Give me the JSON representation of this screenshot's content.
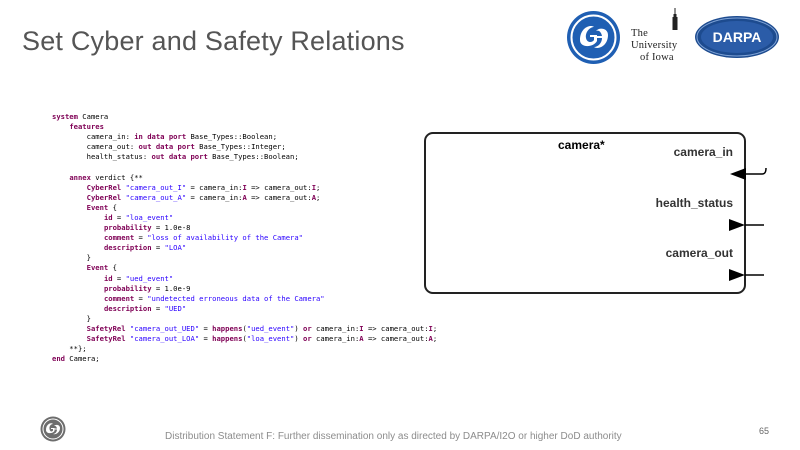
{
  "slide": {
    "title": "Set Cyber and Safety Relations",
    "page_number": "65",
    "footer": "Distribution Statement F: Further dissemination  only as directed by DARPA/I2O or higher DoD authority"
  },
  "logos": {
    "ge": "ge-logo",
    "uiowa_lines": [
      "The",
      "University",
      "of Iowa"
    ],
    "darpa": "DARPA"
  },
  "code": [
    [
      {
        "t": "system",
        "k": "kw"
      },
      {
        "t": " Camera",
        "k": ""
      }
    ],
    [
      {
        "t": "    ",
        "k": ""
      },
      {
        "t": "features",
        "k": "kw"
      }
    ],
    [
      {
        "t": "        camera_in: ",
        "k": ""
      },
      {
        "t": "in data port",
        "k": "kw"
      },
      {
        "t": " Base_Types::Boolean;",
        "k": ""
      }
    ],
    [
      {
        "t": "        camera_out: ",
        "k": ""
      },
      {
        "t": "out data port",
        "k": "kw"
      },
      {
        "t": " Base_Types::Integer;",
        "k": ""
      }
    ],
    [
      {
        "t": "        health_status: ",
        "k": ""
      },
      {
        "t": "out data port",
        "k": "kw"
      },
      {
        "t": " Base_Types::Boolean;",
        "k": ""
      }
    ],
    [
      {
        "t": "",
        "k": ""
      }
    ],
    [
      {
        "t": "    ",
        "k": ""
      },
      {
        "t": "annex",
        "k": "kw"
      },
      {
        "t": " verdict {**",
        "k": ""
      }
    ],
    [
      {
        "t": "        ",
        "k": ""
      },
      {
        "t": "CyberRel",
        "k": "kw"
      },
      {
        "t": " ",
        "k": ""
      },
      {
        "t": "\"camera_out_I\"",
        "k": "str"
      },
      {
        "t": " = camera_in:",
        "k": ""
      },
      {
        "t": "I",
        "k": "kw"
      },
      {
        "t": " => camera_out:",
        "k": ""
      },
      {
        "t": "I",
        "k": "kw"
      },
      {
        "t": ";",
        "k": ""
      }
    ],
    [
      {
        "t": "        ",
        "k": ""
      },
      {
        "t": "CyberRel",
        "k": "kw"
      },
      {
        "t": " ",
        "k": ""
      },
      {
        "t": "\"camera_out_A\"",
        "k": "str"
      },
      {
        "t": " = camera_in:",
        "k": ""
      },
      {
        "t": "A",
        "k": "kw"
      },
      {
        "t": " => camera_out:",
        "k": ""
      },
      {
        "t": "A",
        "k": "kw"
      },
      {
        "t": ";",
        "k": ""
      }
    ],
    [
      {
        "t": "        ",
        "k": ""
      },
      {
        "t": "Event",
        "k": "kw"
      },
      {
        "t": " {",
        "k": ""
      }
    ],
    [
      {
        "t": "            ",
        "k": ""
      },
      {
        "t": "id",
        "k": "kw"
      },
      {
        "t": " = ",
        "k": ""
      },
      {
        "t": "\"loa_event\"",
        "k": "str"
      }
    ],
    [
      {
        "t": "            ",
        "k": ""
      },
      {
        "t": "probability",
        "k": "kw"
      },
      {
        "t": " = 1.0e-8",
        "k": ""
      }
    ],
    [
      {
        "t": "            ",
        "k": ""
      },
      {
        "t": "comment",
        "k": "kw"
      },
      {
        "t": " = ",
        "k": ""
      },
      {
        "t": "\"loss of availability of the Camera\"",
        "k": "str"
      }
    ],
    [
      {
        "t": "            ",
        "k": ""
      },
      {
        "t": "description",
        "k": "kw"
      },
      {
        "t": " = ",
        "k": ""
      },
      {
        "t": "\"LOA\"",
        "k": "str"
      }
    ],
    [
      {
        "t": "        }",
        "k": ""
      }
    ],
    [
      {
        "t": "        ",
        "k": ""
      },
      {
        "t": "Event",
        "k": "kw"
      },
      {
        "t": " {",
        "k": ""
      }
    ],
    [
      {
        "t": "            ",
        "k": ""
      },
      {
        "t": "id",
        "k": "kw"
      },
      {
        "t": " = ",
        "k": ""
      },
      {
        "t": "\"ued_event\"",
        "k": "str"
      }
    ],
    [
      {
        "t": "            ",
        "k": ""
      },
      {
        "t": "probability",
        "k": "kw"
      },
      {
        "t": " = 1.0e-9",
        "k": ""
      }
    ],
    [
      {
        "t": "            ",
        "k": ""
      },
      {
        "t": "comment",
        "k": "kw"
      },
      {
        "t": " = ",
        "k": ""
      },
      {
        "t": "\"undetected erroneous data of the Camera\"",
        "k": "str"
      }
    ],
    [
      {
        "t": "            ",
        "k": ""
      },
      {
        "t": "description",
        "k": "kw"
      },
      {
        "t": " = ",
        "k": ""
      },
      {
        "t": "\"UED\"",
        "k": "str"
      }
    ],
    [
      {
        "t": "        }",
        "k": ""
      }
    ],
    [
      {
        "t": "        ",
        "k": ""
      },
      {
        "t": "SafetyRel",
        "k": "kw"
      },
      {
        "t": " ",
        "k": ""
      },
      {
        "t": "\"camera_out_UED\"",
        "k": "str"
      },
      {
        "t": " = ",
        "k": ""
      },
      {
        "t": "happens",
        "k": "kw"
      },
      {
        "t": "(",
        "k": ""
      },
      {
        "t": "\"ued_event\"",
        "k": "str"
      },
      {
        "t": ") ",
        "k": ""
      },
      {
        "t": "or",
        "k": "kw"
      },
      {
        "t": " camera_in:",
        "k": ""
      },
      {
        "t": "I",
        "k": "kw"
      },
      {
        "t": " => camera_out:",
        "k": ""
      },
      {
        "t": "I",
        "k": "kw"
      },
      {
        "t": ";",
        "k": ""
      }
    ],
    [
      {
        "t": "        ",
        "k": ""
      },
      {
        "t": "SafetyRel",
        "k": "kw"
      },
      {
        "t": " ",
        "k": ""
      },
      {
        "t": "\"camera_out_LOA\"",
        "k": "str"
      },
      {
        "t": " = ",
        "k": ""
      },
      {
        "t": "happens",
        "k": "kw"
      },
      {
        "t": "(",
        "k": ""
      },
      {
        "t": "\"loa_event\"",
        "k": "str"
      },
      {
        "t": ") ",
        "k": ""
      },
      {
        "t": "or",
        "k": "kw"
      },
      {
        "t": " camera_in:",
        "k": ""
      },
      {
        "t": "A",
        "k": "kw"
      },
      {
        "t": " => camera_out:",
        "k": ""
      },
      {
        "t": "A",
        "k": "kw"
      },
      {
        "t": ";",
        "k": ""
      }
    ],
    [
      {
        "t": "    **};",
        "k": ""
      }
    ],
    [
      {
        "t": "end",
        "k": "kw"
      },
      {
        "t": " Camera;",
        "k": ""
      }
    ]
  ],
  "diagram": {
    "component_label": "camera*",
    "ports": [
      {
        "label": "camera_in",
        "direction": "in"
      },
      {
        "label": "health_status",
        "direction": "out"
      },
      {
        "label": "camera_out",
        "direction": "out"
      }
    ]
  },
  "colors": {
    "title": "#555555",
    "keyword": "#7f0055",
    "string": "#2a00ff",
    "ge_blue": "#1f5fb3",
    "darpa_blue": "#2b5ca8"
  }
}
